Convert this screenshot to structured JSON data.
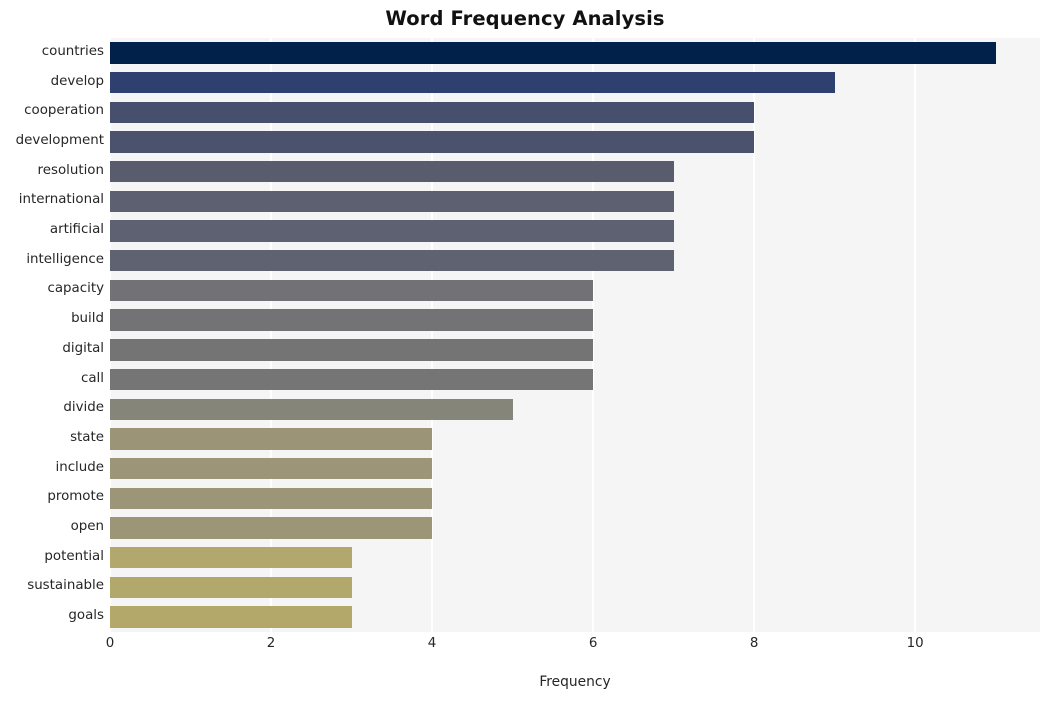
{
  "chart_data": {
    "type": "bar",
    "orientation": "horizontal",
    "title": "Word Frequency Analysis",
    "xlabel": "Frequency",
    "ylabel": "",
    "categories": [
      "countries",
      "develop",
      "cooperation",
      "development",
      "resolution",
      "international",
      "artificial",
      "intelligence",
      "capacity",
      "build",
      "digital",
      "call",
      "divide",
      "state",
      "include",
      "promote",
      "open",
      "potential",
      "sustainable",
      "goals"
    ],
    "values": [
      11,
      9,
      8,
      8,
      7,
      7,
      7,
      7,
      6,
      6,
      6,
      6,
      5,
      4,
      4,
      4,
      4,
      3,
      3,
      3
    ],
    "xlim": [
      0,
      11.55
    ],
    "ylim_categories": 20,
    "xticks": [
      0,
      2,
      4,
      6,
      8,
      10
    ],
    "xtick_labels": [
      "0",
      "2",
      "4",
      "6",
      "8",
      "10"
    ],
    "grid": true,
    "grid_axis": "x",
    "grid_color": "#ffffff",
    "legend": false,
    "plot_background": "#f5f5f5",
    "figure_background": "#ffffff",
    "bar_colors": [
      "#02214a",
      "#2e4070",
      "#464f6d",
      "#4a526e",
      "#585c6c",
      "#5c6070",
      "#5e6171",
      "#5f6271",
      "#727276",
      "#737375",
      "#747475",
      "#757575",
      "#85857a",
      "#9b9477",
      "#9c9578",
      "#9c9577",
      "#9c9576",
      "#b2a76c",
      "#b3a86b",
      "#b3a86a"
    ]
  }
}
